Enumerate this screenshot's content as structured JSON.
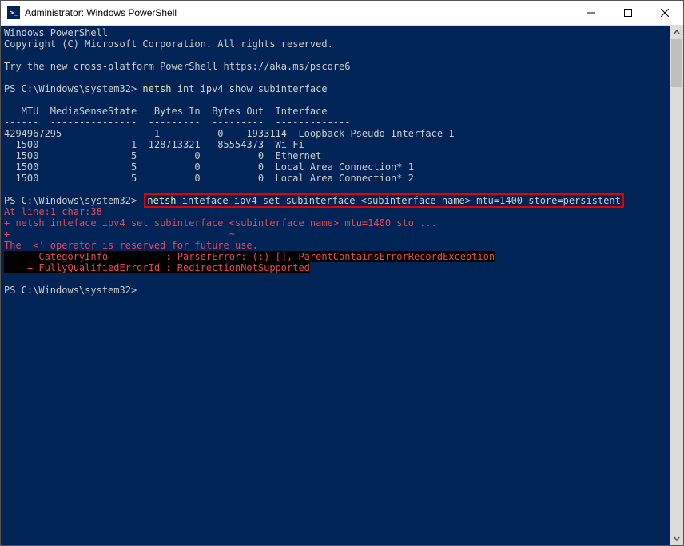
{
  "titlebar": {
    "icon_label": ">_",
    "title": "Administrator: Windows PowerShell"
  },
  "term": {
    "intro": {
      "l1": "Windows PowerShell",
      "l2": "Copyright (C) Microsoft Corporation. All rights reserved.",
      "l3": "Try the new cross-platform PowerShell https://aka.ms/pscore6"
    },
    "prompt": "PS C:\\Windows\\system32>",
    "cmd1": {
      "exe": "netsh",
      "args": " int ipv4 show subinterface"
    },
    "table": {
      "header": "   MTU  MediaSenseState   Bytes In  Bytes Out  Interface",
      "divider": "------  ---------------  ---------  ---------  -------------",
      "rows": [
        "4294967295                1          0    1933114  Loopback Pseudo-Interface 1",
        "  1500                1  128713321   85554373  Wi-Fi",
        "  1500                5          0          0  Ethernet",
        "  1500                5          0          0  Local Area Connection* 1",
        "  1500                5          0          0  Local Area Connection* 2"
      ]
    },
    "cmd2": {
      "exe": "netsh",
      "args_a": " inteface ipv4 set subinterface ",
      "args_b": "<subinterface name>",
      "args_c": " mtu=1400 store=persistent"
    },
    "error": {
      "l1": "At line:1 char:38",
      "l2": "+ netsh inteface ipv4 set subinterface <subinterface name> mtu=1400 sto ...",
      "l3": "+                                      ~",
      "l4": "The '<' operator is reserved for future use.",
      "l5": "    + CategoryInfo          : ParserError: (:) [], ParentContainsErrorRecordException",
      "l6": "    + FullyQualifiedErrorId : RedirectionNotSupported"
    }
  }
}
